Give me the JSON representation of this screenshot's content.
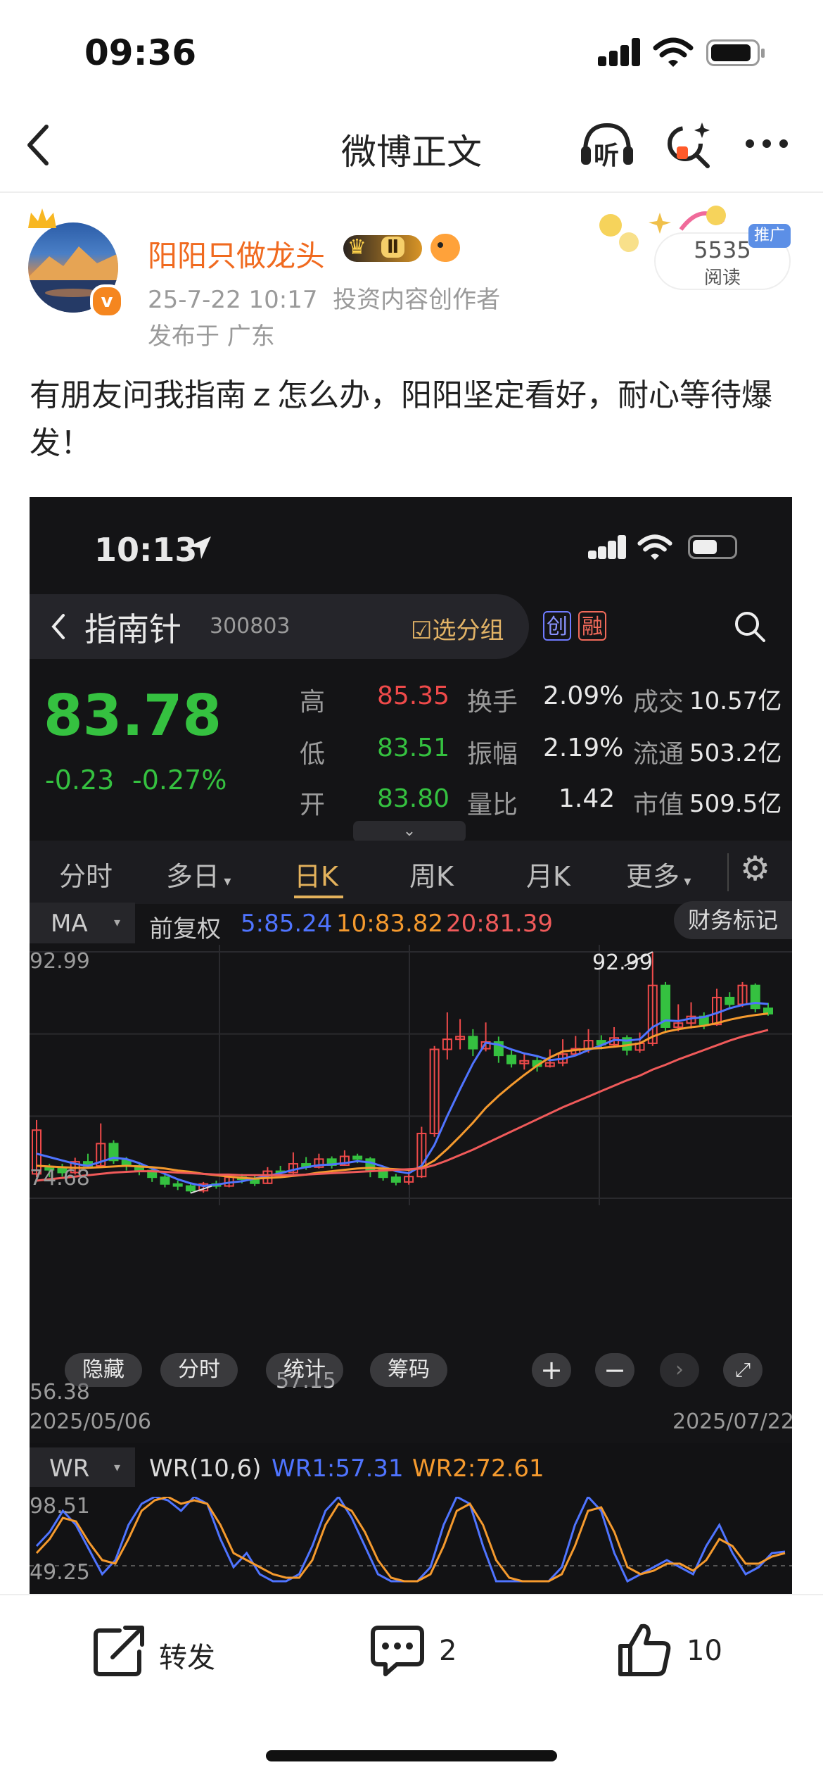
{
  "status_bar": {
    "time": "09:36"
  },
  "nav": {
    "title": "微博正文",
    "listen_label": "听"
  },
  "author": {
    "name": "阳阳只做龙头",
    "level_badge": "Ⅱ"
  },
  "post": {
    "date_time": "25-7-22 10:17",
    "author_tag": "投资内容创作者",
    "location": "发布于 广东",
    "text": "有朋友问我指南ｚ怎么办，阳阳坚定看好，耐心等待爆发！",
    "read_count": "5535",
    "read_label": "阅读",
    "promo_badge": "推广"
  },
  "stock_image": {
    "status_time": "10:13",
    "stock_name": "指南针",
    "stock_code": "300803",
    "watch_label": "选分组",
    "tag_chuang": "创",
    "tag_rong": "融",
    "price": "83.78",
    "change": "-0.23",
    "change_pct": "-0.27%",
    "stats": [
      {
        "label": "高",
        "value": "85.35",
        "color": "red"
      },
      {
        "label": "低",
        "value": "83.51",
        "color": "green"
      },
      {
        "label": "开",
        "value": "83.80",
        "color": "green"
      }
    ],
    "stats2": [
      {
        "label": "换手",
        "value": "2.09%"
      },
      {
        "label": "振幅",
        "value": "2.19%"
      },
      {
        "label": "量比",
        "value": "1.42"
      }
    ],
    "stats3": [
      {
        "label": "成交",
        "value": "10.57亿"
      },
      {
        "label": "流通",
        "value": "503.2亿"
      },
      {
        "label": "市值",
        "value": "509.5亿"
      }
    ],
    "tabs": [
      "分时",
      "多日",
      "日K",
      "周K",
      "月K",
      "更多"
    ],
    "active_tab": "日K",
    "ma_label": "MA",
    "adjust_label": "前复权",
    "ma5": "5:85.24",
    "ma10": "10:83.82",
    "ma20": "20:81.39",
    "finance_label": "财务标记",
    "ylabels": {
      "top": "92.99",
      "mid": "74.68",
      "low": "56.38"
    },
    "peak_label": "92.99",
    "low_label": "57.15",
    "date_start": "2025/05/06",
    "date_end": "2025/07/22",
    "overlay_buttons": [
      "隐藏",
      "分时",
      "统计",
      "筹码"
    ],
    "wr_label": "WR",
    "wr_param": "WR(10,6)",
    "wr1": "WR1:57.31",
    "wr2": "WR2:72.61",
    "wr_top": "98.51",
    "wr_mid": "49.25",
    "colors": {
      "ma5": "#4f74ff",
      "ma10": "#f59a2e",
      "ma20": "#f05a5a",
      "up": "#ef4a4a",
      "down": "#35c140"
    }
  },
  "chart_data": {
    "type": "candlestick",
    "title": "",
    "xlabel": "",
    "ylabel": "",
    "x_range": [
      "2025/05/06",
      "2025/07/22"
    ],
    "ylim": [
      56.38,
      92.99
    ],
    "y_ticks": [
      92.99,
      74.68,
      56.38
    ],
    "annotations": [
      {
        "label": "92.99",
        "kind": "high"
      },
      {
        "label": "57.15",
        "kind": "low"
      }
    ],
    "candles": [
      {
        "o": 60,
        "c": 66.5,
        "h": 68,
        "l": 59.5
      },
      {
        "o": 61,
        "c": 60.6,
        "h": 61.5,
        "l": 59.5
      },
      {
        "o": 60.8,
        "c": 60.2,
        "h": 61.5,
        "l": 59.6
      },
      {
        "o": 60.2,
        "c": 61.8,
        "h": 62.4,
        "l": 59.9
      },
      {
        "o": 61.8,
        "c": 61.2,
        "h": 63,
        "l": 60.8
      },
      {
        "o": 61.2,
        "c": 64.5,
        "h": 67.5,
        "l": 61
      },
      {
        "o": 64.5,
        "c": 62,
        "h": 65,
        "l": 61.5
      },
      {
        "o": 62,
        "c": 61.2,
        "h": 62.5,
        "l": 60.5
      },
      {
        "o": 61.2,
        "c": 60.5,
        "h": 61.5,
        "l": 59.8
      },
      {
        "o": 60.5,
        "c": 59.5,
        "h": 61,
        "l": 58.8
      },
      {
        "o": 59.5,
        "c": 58.5,
        "h": 60,
        "l": 58
      },
      {
        "o": 58.5,
        "c": 58.2,
        "h": 59,
        "l": 57.6
      },
      {
        "o": 58.2,
        "c": 57.5,
        "h": 58.6,
        "l": 57.15
      },
      {
        "o": 57.5,
        "c": 58.5,
        "h": 58.8,
        "l": 57.2
      },
      {
        "o": 58.5,
        "c": 58.2,
        "h": 59,
        "l": 57.8
      },
      {
        "o": 58.2,
        "c": 59.5,
        "h": 60,
        "l": 58
      },
      {
        "o": 59.5,
        "c": 59.2,
        "h": 60,
        "l": 58.6
      },
      {
        "o": 59.2,
        "c": 58.6,
        "h": 59.8,
        "l": 58.2
      },
      {
        "o": 58.6,
        "c": 60.4,
        "h": 61,
        "l": 58.5
      },
      {
        "o": 60.4,
        "c": 60.2,
        "h": 61.2,
        "l": 59.8
      },
      {
        "o": 60.2,
        "c": 61.5,
        "h": 63.2,
        "l": 60
      },
      {
        "o": 61.5,
        "c": 61,
        "h": 62.5,
        "l": 60.6
      },
      {
        "o": 61,
        "c": 62.2,
        "h": 63,
        "l": 60.8
      },
      {
        "o": 62.2,
        "c": 61.3,
        "h": 62.6,
        "l": 60.8
      },
      {
        "o": 61.3,
        "c": 62.6,
        "h": 63.5,
        "l": 61.2
      },
      {
        "o": 62.6,
        "c": 62.2,
        "h": 63,
        "l": 61.6
      },
      {
        "o": 62.2,
        "c": 60.6,
        "h": 62.5,
        "l": 59.5
      },
      {
        "o": 60.6,
        "c": 59.5,
        "h": 61,
        "l": 59
      },
      {
        "o": 59.5,
        "c": 58.8,
        "h": 60,
        "l": 58.3
      },
      {
        "o": 58.8,
        "c": 59.6,
        "h": 60.4,
        "l": 58.4
      },
      {
        "o": 59.6,
        "c": 66,
        "h": 67,
        "l": 59.4
      },
      {
        "o": 66,
        "c": 78.5,
        "h": 79,
        "l": 65.5
      },
      {
        "o": 78.5,
        "c": 80,
        "h": 84,
        "l": 77
      },
      {
        "o": 80,
        "c": 80.4,
        "h": 83,
        "l": 78.5
      },
      {
        "o": 80.4,
        "c": 78.6,
        "h": 81.5,
        "l": 77.5
      },
      {
        "o": 78.6,
        "c": 79.6,
        "h": 82.5,
        "l": 78.2
      },
      {
        "o": 79.6,
        "c": 77.6,
        "h": 80.4,
        "l": 76.5
      },
      {
        "o": 77.6,
        "c": 76.4,
        "h": 78.6,
        "l": 75.8
      },
      {
        "o": 76.4,
        "c": 76.8,
        "h": 78,
        "l": 75.5
      },
      {
        "o": 76.8,
        "c": 76,
        "h": 77.5,
        "l": 75.2
      },
      {
        "o": 76,
        "c": 76.5,
        "h": 78.5,
        "l": 75.8
      },
      {
        "o": 76.5,
        "c": 77.8,
        "h": 80,
        "l": 76
      },
      {
        "o": 77.8,
        "c": 78.6,
        "h": 80.5,
        "l": 77.5
      },
      {
        "o": 78.6,
        "c": 79.8,
        "h": 81.5,
        "l": 78
      },
      {
        "o": 79.8,
        "c": 79.2,
        "h": 80.6,
        "l": 78.5
      },
      {
        "o": 79.2,
        "c": 80.2,
        "h": 81.8,
        "l": 79
      },
      {
        "o": 80.2,
        "c": 78.4,
        "h": 80.6,
        "l": 77.6
      },
      {
        "o": 78.4,
        "c": 79.4,
        "h": 81,
        "l": 78
      },
      {
        "o": 79.4,
        "c": 88,
        "h": 92.99,
        "l": 79
      },
      {
        "o": 88,
        "c": 81.8,
        "h": 88.5,
        "l": 81
      },
      {
        "o": 81.8,
        "c": 82.4,
        "h": 85.2,
        "l": 81.2
      },
      {
        "o": 82.4,
        "c": 83.4,
        "h": 85.5,
        "l": 81.6
      },
      {
        "o": 83.4,
        "c": 82.2,
        "h": 84,
        "l": 81.5
      },
      {
        "o": 82.2,
        "c": 86.2,
        "h": 87.5,
        "l": 82
      },
      {
        "o": 86.2,
        "c": 85.2,
        "h": 87,
        "l": 84.6
      },
      {
        "o": 85.2,
        "c": 88,
        "h": 88.5,
        "l": 84.8
      },
      {
        "o": 88,
        "c": 84.6,
        "h": 88.3,
        "l": 84
      },
      {
        "o": 84.6,
        "c": 83.8,
        "h": 85.4,
        "l": 83.5
      }
    ],
    "series": [
      {
        "name": "5:85.24",
        "values": [
          63,
          62.5,
          62,
          61.5,
          61.2,
          61.8,
          62.4,
          62.2,
          61.6,
          60.8,
          60,
          59.2,
          58.6,
          58.2,
          58.4,
          58.7,
          58.9,
          59.3,
          59.7,
          60.1,
          60.6,
          61,
          61.3,
          61.4,
          61.6,
          61.9,
          61.7,
          61.1,
          60.4,
          60.1,
          61.2,
          64.3,
          68.6,
          72.6,
          76.4,
          79.5,
          79.2,
          78.5,
          77.9,
          77.5,
          76.9,
          77.1,
          77.6,
          78.4,
          79.1,
          79.9,
          79.8,
          80,
          81.8,
          82.8,
          82.7,
          83.1,
          83.3,
          83.9,
          84.6,
          85.1,
          85.4,
          85.24
        ]
      },
      {
        "name": "10:83.82",
        "values": [
          61.2,
          61.1,
          61,
          60.9,
          60.9,
          61,
          61.1,
          61.2,
          61.1,
          61,
          60.8,
          60.5,
          60.3,
          60,
          59.8,
          59.6,
          59.4,
          59.3,
          59.4,
          59.5,
          59.7,
          59.9,
          60.2,
          60.4,
          60.6,
          60.8,
          60.9,
          60.8,
          60.7,
          60.6,
          60.9,
          62,
          63.7,
          65.6,
          67.6,
          69.8,
          71.6,
          73.2,
          74.7,
          76.1,
          77.3,
          78.2,
          78.4,
          78.6,
          78.7,
          78.9,
          79.1,
          79.4,
          80.4,
          81.1,
          81.5,
          81.8,
          82,
          82.4,
          82.9,
          83.3,
          83.6,
          83.82
        ]
      },
      {
        "name": "20:81.39",
        "values": [
          59,
          59.2,
          59.4,
          59.6,
          59.8,
          60,
          60.2,
          60.3,
          60.4,
          60.4,
          60.3,
          60.2,
          60.1,
          60,
          59.9,
          59.9,
          59.8,
          59.8,
          59.8,
          59.8,
          59.8,
          59.9,
          60,
          60.1,
          60.2,
          60.3,
          60.4,
          60.5,
          60.6,
          60.7,
          60.8,
          61.3,
          62,
          62.8,
          63.6,
          64.5,
          65.4,
          66.3,
          67.2,
          68.1,
          69,
          69.9,
          70.7,
          71.5,
          72.3,
          73.1,
          73.9,
          74.6,
          75.5,
          76.2,
          77,
          77.7,
          78.4,
          79.1,
          79.8,
          80.4,
          80.9,
          81.39
        ]
      }
    ]
  },
  "actions": {
    "repost_label": "转发",
    "comment_count": "2",
    "like_count": "10"
  }
}
